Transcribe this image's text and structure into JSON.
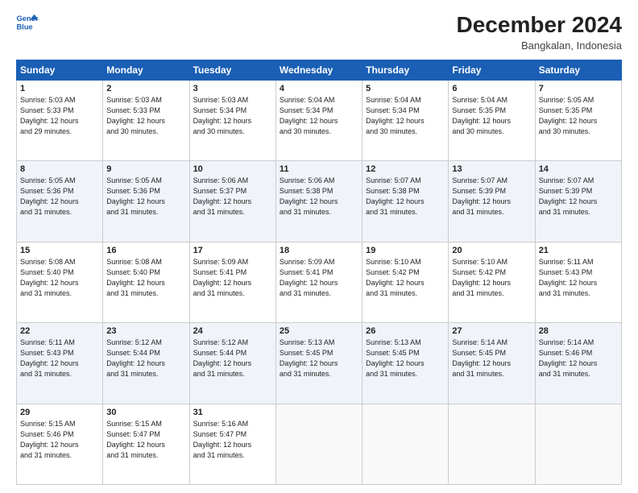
{
  "header": {
    "logo_line1": "General",
    "logo_line2": "Blue",
    "month": "December 2024",
    "location": "Bangkalan, Indonesia"
  },
  "weekdays": [
    "Sunday",
    "Monday",
    "Tuesday",
    "Wednesday",
    "Thursday",
    "Friday",
    "Saturday"
  ],
  "weeks": [
    [
      {
        "day": "1",
        "lines": [
          "Sunrise: 5:03 AM",
          "Sunset: 5:33 PM",
          "Daylight: 12 hours",
          "and 29 minutes."
        ]
      },
      {
        "day": "2",
        "lines": [
          "Sunrise: 5:03 AM",
          "Sunset: 5:33 PM",
          "Daylight: 12 hours",
          "and 30 minutes."
        ]
      },
      {
        "day": "3",
        "lines": [
          "Sunrise: 5:03 AM",
          "Sunset: 5:34 PM",
          "Daylight: 12 hours",
          "and 30 minutes."
        ]
      },
      {
        "day": "4",
        "lines": [
          "Sunrise: 5:04 AM",
          "Sunset: 5:34 PM",
          "Daylight: 12 hours",
          "and 30 minutes."
        ]
      },
      {
        "day": "5",
        "lines": [
          "Sunrise: 5:04 AM",
          "Sunset: 5:34 PM",
          "Daylight: 12 hours",
          "and 30 minutes."
        ]
      },
      {
        "day": "6",
        "lines": [
          "Sunrise: 5:04 AM",
          "Sunset: 5:35 PM",
          "Daylight: 12 hours",
          "and 30 minutes."
        ]
      },
      {
        "day": "7",
        "lines": [
          "Sunrise: 5:05 AM",
          "Sunset: 5:35 PM",
          "Daylight: 12 hours",
          "and 30 minutes."
        ]
      }
    ],
    [
      {
        "day": "8",
        "lines": [
          "Sunrise: 5:05 AM",
          "Sunset: 5:36 PM",
          "Daylight: 12 hours",
          "and 31 minutes."
        ]
      },
      {
        "day": "9",
        "lines": [
          "Sunrise: 5:05 AM",
          "Sunset: 5:36 PM",
          "Daylight: 12 hours",
          "and 31 minutes."
        ]
      },
      {
        "day": "10",
        "lines": [
          "Sunrise: 5:06 AM",
          "Sunset: 5:37 PM",
          "Daylight: 12 hours",
          "and 31 minutes."
        ]
      },
      {
        "day": "11",
        "lines": [
          "Sunrise: 5:06 AM",
          "Sunset: 5:38 PM",
          "Daylight: 12 hours",
          "and 31 minutes."
        ]
      },
      {
        "day": "12",
        "lines": [
          "Sunrise: 5:07 AM",
          "Sunset: 5:38 PM",
          "Daylight: 12 hours",
          "and 31 minutes."
        ]
      },
      {
        "day": "13",
        "lines": [
          "Sunrise: 5:07 AM",
          "Sunset: 5:39 PM",
          "Daylight: 12 hours",
          "and 31 minutes."
        ]
      },
      {
        "day": "14",
        "lines": [
          "Sunrise: 5:07 AM",
          "Sunset: 5:39 PM",
          "Daylight: 12 hours",
          "and 31 minutes."
        ]
      }
    ],
    [
      {
        "day": "15",
        "lines": [
          "Sunrise: 5:08 AM",
          "Sunset: 5:40 PM",
          "Daylight: 12 hours",
          "and 31 minutes."
        ]
      },
      {
        "day": "16",
        "lines": [
          "Sunrise: 5:08 AM",
          "Sunset: 5:40 PM",
          "Daylight: 12 hours",
          "and 31 minutes."
        ]
      },
      {
        "day": "17",
        "lines": [
          "Sunrise: 5:09 AM",
          "Sunset: 5:41 PM",
          "Daylight: 12 hours",
          "and 31 minutes."
        ]
      },
      {
        "day": "18",
        "lines": [
          "Sunrise: 5:09 AM",
          "Sunset: 5:41 PM",
          "Daylight: 12 hours",
          "and 31 minutes."
        ]
      },
      {
        "day": "19",
        "lines": [
          "Sunrise: 5:10 AM",
          "Sunset: 5:42 PM",
          "Daylight: 12 hours",
          "and 31 minutes."
        ]
      },
      {
        "day": "20",
        "lines": [
          "Sunrise: 5:10 AM",
          "Sunset: 5:42 PM",
          "Daylight: 12 hours",
          "and 31 minutes."
        ]
      },
      {
        "day": "21",
        "lines": [
          "Sunrise: 5:11 AM",
          "Sunset: 5:43 PM",
          "Daylight: 12 hours",
          "and 31 minutes."
        ]
      }
    ],
    [
      {
        "day": "22",
        "lines": [
          "Sunrise: 5:11 AM",
          "Sunset: 5:43 PM",
          "Daylight: 12 hours",
          "and 31 minutes."
        ]
      },
      {
        "day": "23",
        "lines": [
          "Sunrise: 5:12 AM",
          "Sunset: 5:44 PM",
          "Daylight: 12 hours",
          "and 31 minutes."
        ]
      },
      {
        "day": "24",
        "lines": [
          "Sunrise: 5:12 AM",
          "Sunset: 5:44 PM",
          "Daylight: 12 hours",
          "and 31 minutes."
        ]
      },
      {
        "day": "25",
        "lines": [
          "Sunrise: 5:13 AM",
          "Sunset: 5:45 PM",
          "Daylight: 12 hours",
          "and 31 minutes."
        ]
      },
      {
        "day": "26",
        "lines": [
          "Sunrise: 5:13 AM",
          "Sunset: 5:45 PM",
          "Daylight: 12 hours",
          "and 31 minutes."
        ]
      },
      {
        "day": "27",
        "lines": [
          "Sunrise: 5:14 AM",
          "Sunset: 5:45 PM",
          "Daylight: 12 hours",
          "and 31 minutes."
        ]
      },
      {
        "day": "28",
        "lines": [
          "Sunrise: 5:14 AM",
          "Sunset: 5:46 PM",
          "Daylight: 12 hours",
          "and 31 minutes."
        ]
      }
    ],
    [
      {
        "day": "29",
        "lines": [
          "Sunrise: 5:15 AM",
          "Sunset: 5:46 PM",
          "Daylight: 12 hours",
          "and 31 minutes."
        ]
      },
      {
        "day": "30",
        "lines": [
          "Sunrise: 5:15 AM",
          "Sunset: 5:47 PM",
          "Daylight: 12 hours",
          "and 31 minutes."
        ]
      },
      {
        "day": "31",
        "lines": [
          "Sunrise: 5:16 AM",
          "Sunset: 5:47 PM",
          "Daylight: 12 hours",
          "and 31 minutes."
        ]
      },
      null,
      null,
      null,
      null
    ]
  ]
}
